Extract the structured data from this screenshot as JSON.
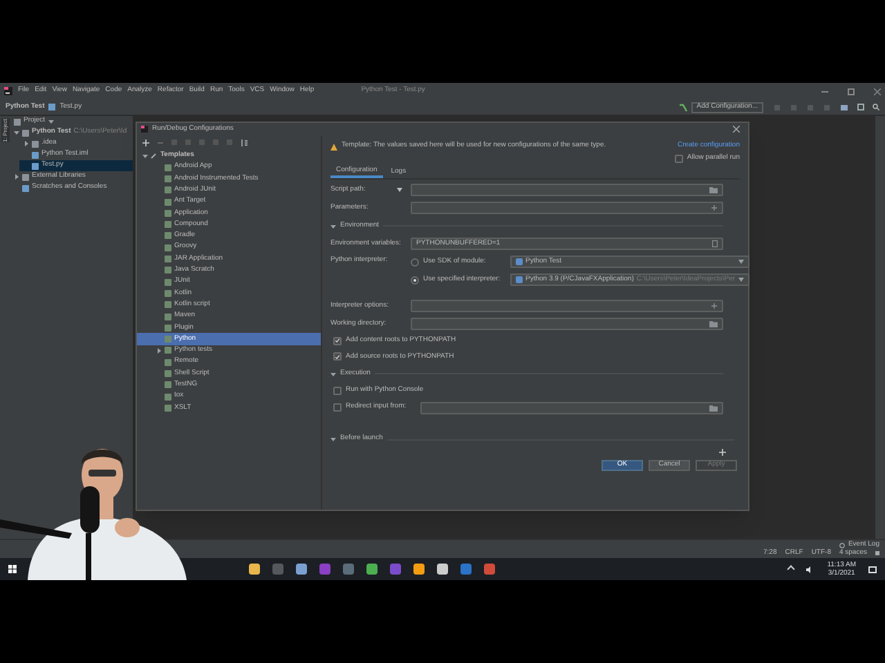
{
  "window_title": "Python Test - Test.py",
  "menu": [
    "File",
    "Edit",
    "View",
    "Navigate",
    "Code",
    "Analyze",
    "Refactor",
    "Build",
    "Run",
    "Tools",
    "VCS",
    "Window",
    "Help"
  ],
  "breadcrumb": [
    "Python Test",
    "Test.py"
  ],
  "add_configuration": "Add Configuration...",
  "side_tab": "1: Project",
  "project": {
    "title": "Project",
    "tree": [
      {
        "label": "Python Test",
        "path": "C:\\Users\\Peter\\Id",
        "selected": false,
        "expanded": true,
        "children": [
          {
            "label": ".idea",
            "selected": false,
            "expanded": false
          },
          {
            "label": "Python Test.iml",
            "selected": false
          },
          {
            "label": "Test.py",
            "selected": true
          }
        ]
      },
      {
        "label": "External Libraries",
        "selected": false,
        "expanded": false
      },
      {
        "label": "Scratches and Consoles",
        "selected": false
      }
    ]
  },
  "dialog": {
    "title": "Run/Debug Configurations",
    "templates_label": "Templates",
    "templates": [
      {
        "label": "Android App",
        "selected": false
      },
      {
        "label": "Android Instrumented Tests",
        "selected": false
      },
      {
        "label": "Android JUnit",
        "selected": false
      },
      {
        "label": "Ant Target",
        "selected": false
      },
      {
        "label": "Application",
        "selected": false
      },
      {
        "label": "Compound",
        "selected": false
      },
      {
        "label": "Gradle",
        "selected": false
      },
      {
        "label": "Groovy",
        "selected": false
      },
      {
        "label": "JAR Application",
        "selected": false
      },
      {
        "label": "Java Scratch",
        "selected": false
      },
      {
        "label": "JUnit",
        "selected": false
      },
      {
        "label": "Kotlin",
        "selected": false
      },
      {
        "label": "Kotlin script",
        "selected": false
      },
      {
        "label": "Maven",
        "selected": false
      },
      {
        "label": "Plugin",
        "selected": false
      },
      {
        "label": "Python",
        "selected": true
      },
      {
        "label": "Python tests",
        "selected": false,
        "expanded": false
      },
      {
        "label": "Remote",
        "selected": false
      },
      {
        "label": "Shell Script",
        "selected": false
      },
      {
        "label": "TestNG",
        "selected": false
      },
      {
        "label": "tox",
        "selected": false
      },
      {
        "label": "XSLT",
        "selected": false
      }
    ],
    "warning": "Template: The values saved here will be used for new configurations of the same type.",
    "create_link": "Create configuration",
    "allow_parallel": {
      "label": "Allow parallel run",
      "checked": false
    },
    "tabs": [
      {
        "label": "Configuration",
        "selected": true
      },
      {
        "label": "Logs",
        "selected": false
      }
    ],
    "script_path_label": "Script path:",
    "parameters_label": "Parameters:",
    "environment": {
      "title": "Environment",
      "env_label": "Environment variables:",
      "env_value": "PYTHONUNBUFFERED=1",
      "interpreter_label": "Python interpreter:",
      "options": [
        {
          "label": "Use SDK of module:",
          "selected": false,
          "value": "Python Test"
        },
        {
          "label": "Use specified interpreter:",
          "selected": true,
          "value": "Python 3.9 (P/CJavaFXApplication)",
          "path": "C:\\Users\\Peter\\IdeaProjects\\Per"
        }
      ],
      "interp_opts_label": "Interpreter options:",
      "workdir_label": "Working directory:",
      "checks": [
        {
          "label": "Add content roots to PYTHONPATH",
          "checked": true
        },
        {
          "label": "Add source roots to PYTHONPATH",
          "checked": true
        }
      ]
    },
    "execution": {
      "title": "Execution",
      "checks": [
        {
          "label": "Run with Python Console",
          "checked": false
        },
        {
          "label": "Redirect input from:",
          "checked": false
        }
      ]
    },
    "before_launch": "Before launch",
    "buttons": [
      {
        "label": "OK",
        "kind": "primary",
        "disabled": false
      },
      {
        "label": "Cancel",
        "kind": "secondary",
        "disabled": false
      },
      {
        "label": "Apply",
        "kind": "secondary",
        "disabled": true
      }
    ]
  },
  "event_log": "Event Log",
  "status": [
    "7:28",
    "CRLF",
    "UTF-8",
    "4 spaces"
  ],
  "clock": {
    "time": "11:13 AM",
    "date": "3/1/2021"
  }
}
